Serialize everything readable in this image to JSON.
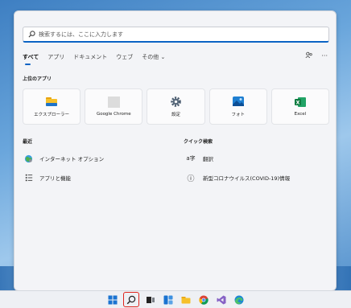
{
  "search": {
    "placeholder": "検索するには、ここに入力します"
  },
  "filter_tabs": [
    {
      "label": "すべて",
      "active": true
    },
    {
      "label": "アプリ",
      "active": false
    },
    {
      "label": "ドキュメント",
      "active": false
    },
    {
      "label": "ウェブ",
      "active": false
    },
    {
      "label": "その他 ⌄",
      "active": false
    }
  ],
  "top_right": {
    "account_icon": "account-switch-icon",
    "more_label": "···"
  },
  "sections": {
    "top_apps": "上位のアプリ",
    "recent": "最近",
    "quick_search": "クイック検索"
  },
  "top_apps": [
    {
      "label": "エクスプローラー",
      "icon": "folder-icon",
      "color": "#f2b51c"
    },
    {
      "label": "Google Chrome",
      "icon": "chrome-placeholder-icon",
      "color": "#d9d9d9"
    },
    {
      "label": "設定",
      "icon": "gear-icon",
      "color": "#5a6b7d"
    },
    {
      "label": "フォト",
      "icon": "photos-icon",
      "color": "#1f7fd1"
    },
    {
      "label": "Excel",
      "icon": "excel-icon",
      "color": "#1d6f42"
    }
  ],
  "recent": [
    {
      "label": "インターネット オプション",
      "icon": "internet-options-icon"
    },
    {
      "label": "アプリと機能",
      "icon": "apps-features-icon"
    }
  ],
  "quick_search": [
    {
      "label": "翻訳",
      "glyph": "a字",
      "icon": "translate-icon"
    },
    {
      "label": "新型コロナウイルス(COVID-19)情報",
      "glyph": "ⓘ",
      "icon": "info-icon"
    }
  ],
  "taskbar": [
    {
      "name": "windows-start-icon"
    },
    {
      "name": "search-icon",
      "highlight": true
    },
    {
      "name": "task-view-icon"
    },
    {
      "name": "widgets-icon"
    },
    {
      "name": "file-explorer-icon"
    },
    {
      "name": "chrome-icon"
    },
    {
      "name": "visual-studio-icon"
    },
    {
      "name": "edge-icon"
    }
  ],
  "colors": {
    "accent": "#0b63c4",
    "highlight": "#e0241c"
  }
}
